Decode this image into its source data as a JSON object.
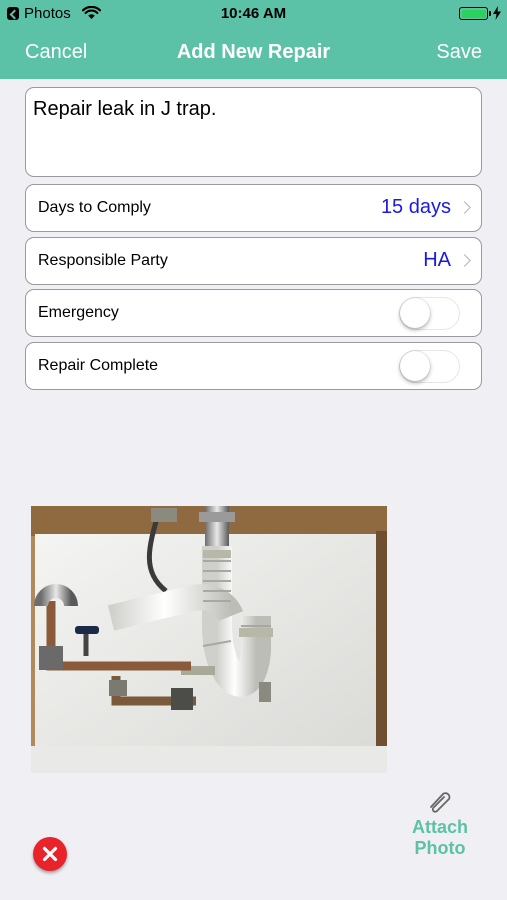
{
  "status_bar": {
    "back_app": "Photos",
    "time": "10:46 AM"
  },
  "nav": {
    "cancel": "Cancel",
    "title": "Add New Repair",
    "save": "Save"
  },
  "description": "Repair leak in J trap.",
  "fields": {
    "days_to_comply": {
      "label": "Days to Comply",
      "value": "15 days"
    },
    "responsible_party": {
      "label": "Responsible Party",
      "value": "HA"
    },
    "emergency": {
      "label": "Emergency",
      "on": false
    },
    "repair_complete": {
      "label": "Repair Complete",
      "on": false
    }
  },
  "attachment": {
    "photo_subject": "under-sink plumbing with white PVC J trap",
    "attach_label_line1": "Attach",
    "attach_label_line2": "Photo"
  },
  "colors": {
    "accent": "#5cc2a7",
    "value_blue": "#1a1ae0",
    "delete_red": "#e8242a"
  }
}
